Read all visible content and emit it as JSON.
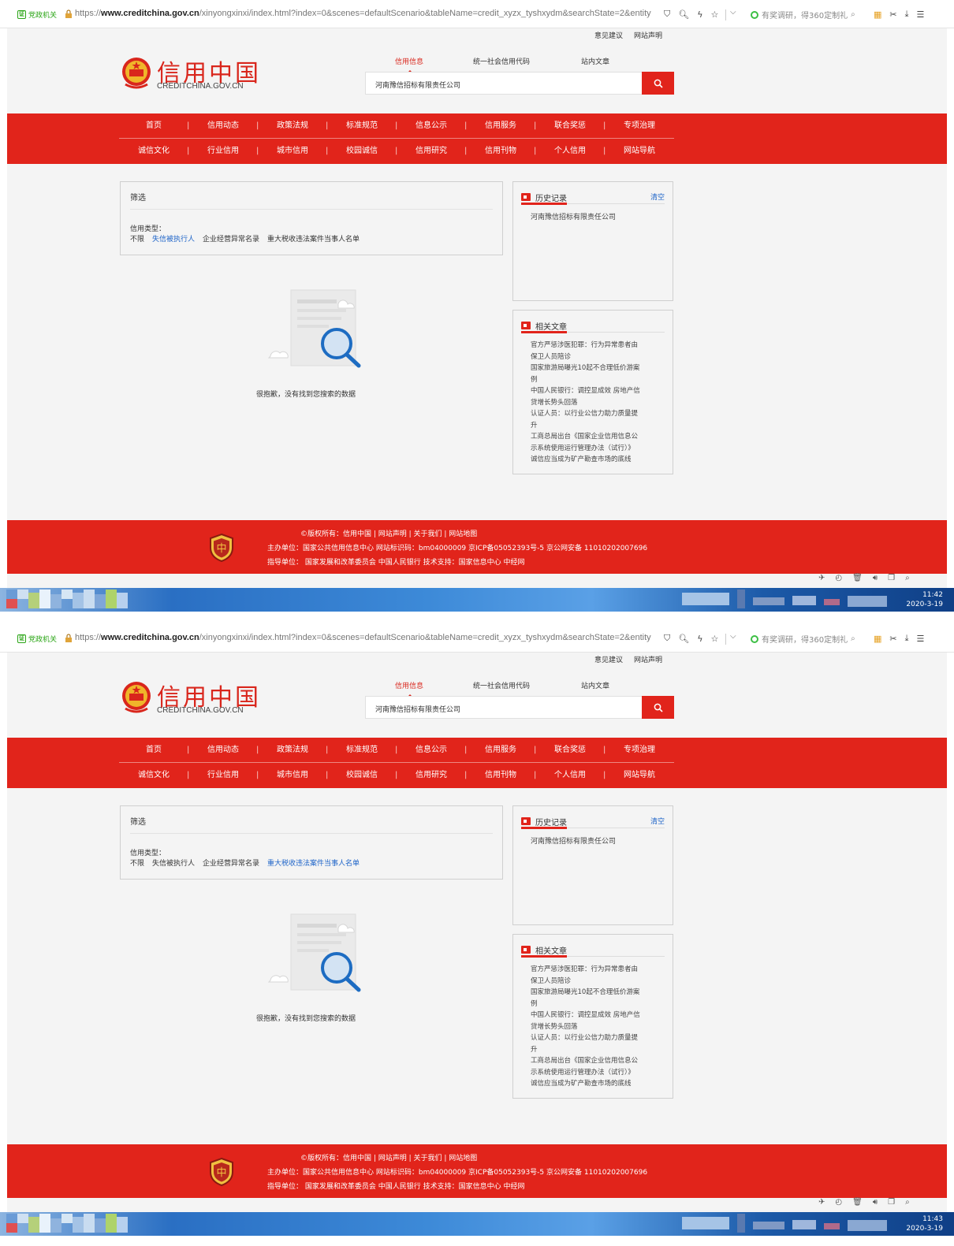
{
  "browser": {
    "gov_badge": "党政机关",
    "url_prefix": "https://",
    "url_domain": "www.creditchina.gov.cn",
    "url_path": "/xinyongxinxi/index.html?index=0&scenes=defaultScenario&tableName=credit_xyzx_tyshxydm&searchState=2&entity",
    "ad_text": "有奖调研，得360定制礼"
  },
  "header": {
    "top_links": [
      "意见建议",
      "网站声明"
    ],
    "logo_cn": "信用中国",
    "logo_en": "CREDITCHINA.GOV.CN",
    "search_tabs": [
      "信用信息",
      "统一社会信用代码",
      "站内文章"
    ],
    "search_value": "河南豫信招标有限责任公司"
  },
  "nav": {
    "row1": [
      "首页",
      "信用动态",
      "政策法规",
      "标准规范",
      "信息公示",
      "信用服务",
      "联合奖惩",
      "专项治理"
    ],
    "row2": [
      "诚信文化",
      "行业信用",
      "城市信用",
      "校园诚信",
      "信用研究",
      "信用刊物",
      "个人信用",
      "网站导航"
    ]
  },
  "filter": {
    "title": "筛选",
    "label": "信用类型：",
    "options": [
      "不限",
      "失信被执行人",
      "企业经营异常名录",
      "重大税收违法案件当事人名单"
    ]
  },
  "screens": [
    {
      "selected_index": 1,
      "clock_time": "11:42",
      "clock_date": "2020-3-19"
    },
    {
      "selected_index": 3,
      "clock_time": "11:43",
      "clock_date": "2020-3-19"
    }
  ],
  "empty_text": "很抱歉，没有找到您搜索的数据",
  "history": {
    "title": "历史记录",
    "clear": "清空",
    "items": [
      "河南豫信招标有限责任公司"
    ]
  },
  "related": {
    "title": "相关文章",
    "items": [
      "官方严惩涉医犯罪：行为异常患者由",
      "保卫人员陪诊",
      "国家旅游局曝光10起不合理低价游案",
      "例",
      "中国人民银行：调控显成效 房地产信",
      "贷增长势头回落",
      "认证人员：以行业公信力助力质量提",
      "升",
      "工商总局出台《国家企业信用信息公",
      "示系统使用运行管理办法（试行）》",
      "诚信应当成为矿产勘查市场的底线"
    ]
  },
  "footer": {
    "line1": "©版权所有：信用中国 |  网站声明 |  关于我们 |  网站地图",
    "line2": "主办单位：国家公共信用信息中心 网站标识码：bm04000009 京ICP备05052393号-5  京公网安备 11010202007696",
    "line3": "指导单位： 国家发展和改革委员会 中国人民银行 技术支持：国家信息中心 中经网"
  },
  "colors": {
    "brand_red": "#e1241b",
    "link_blue": "#1e64c8",
    "panel_bg": "#f4f4f4"
  }
}
